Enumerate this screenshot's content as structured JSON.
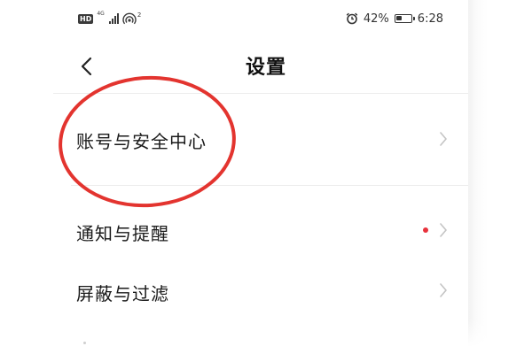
{
  "status_bar": {
    "hd_badge": "HD",
    "network_label": "4G",
    "hotspot_count": "2",
    "battery_percent": "42%",
    "battery_level": 0.42,
    "time": "6:28",
    "icons": [
      "alarm-icon",
      "battery-icon",
      "signal-icon",
      "hotspot-icon"
    ]
  },
  "header": {
    "title": "设置",
    "back_icon": "chevron-left-icon"
  },
  "settings": {
    "items": [
      {
        "label": "账号与安全中心",
        "has_dot": false
      },
      {
        "label": "通知与提醒",
        "has_dot": true
      },
      {
        "label": "屏蔽与过滤",
        "has_dot": false
      }
    ]
  },
  "colors": {
    "annotation": "#e3342f",
    "notification_dot": "#e8323c",
    "chevron": "#c4c4c4",
    "divider": "#ececec"
  }
}
